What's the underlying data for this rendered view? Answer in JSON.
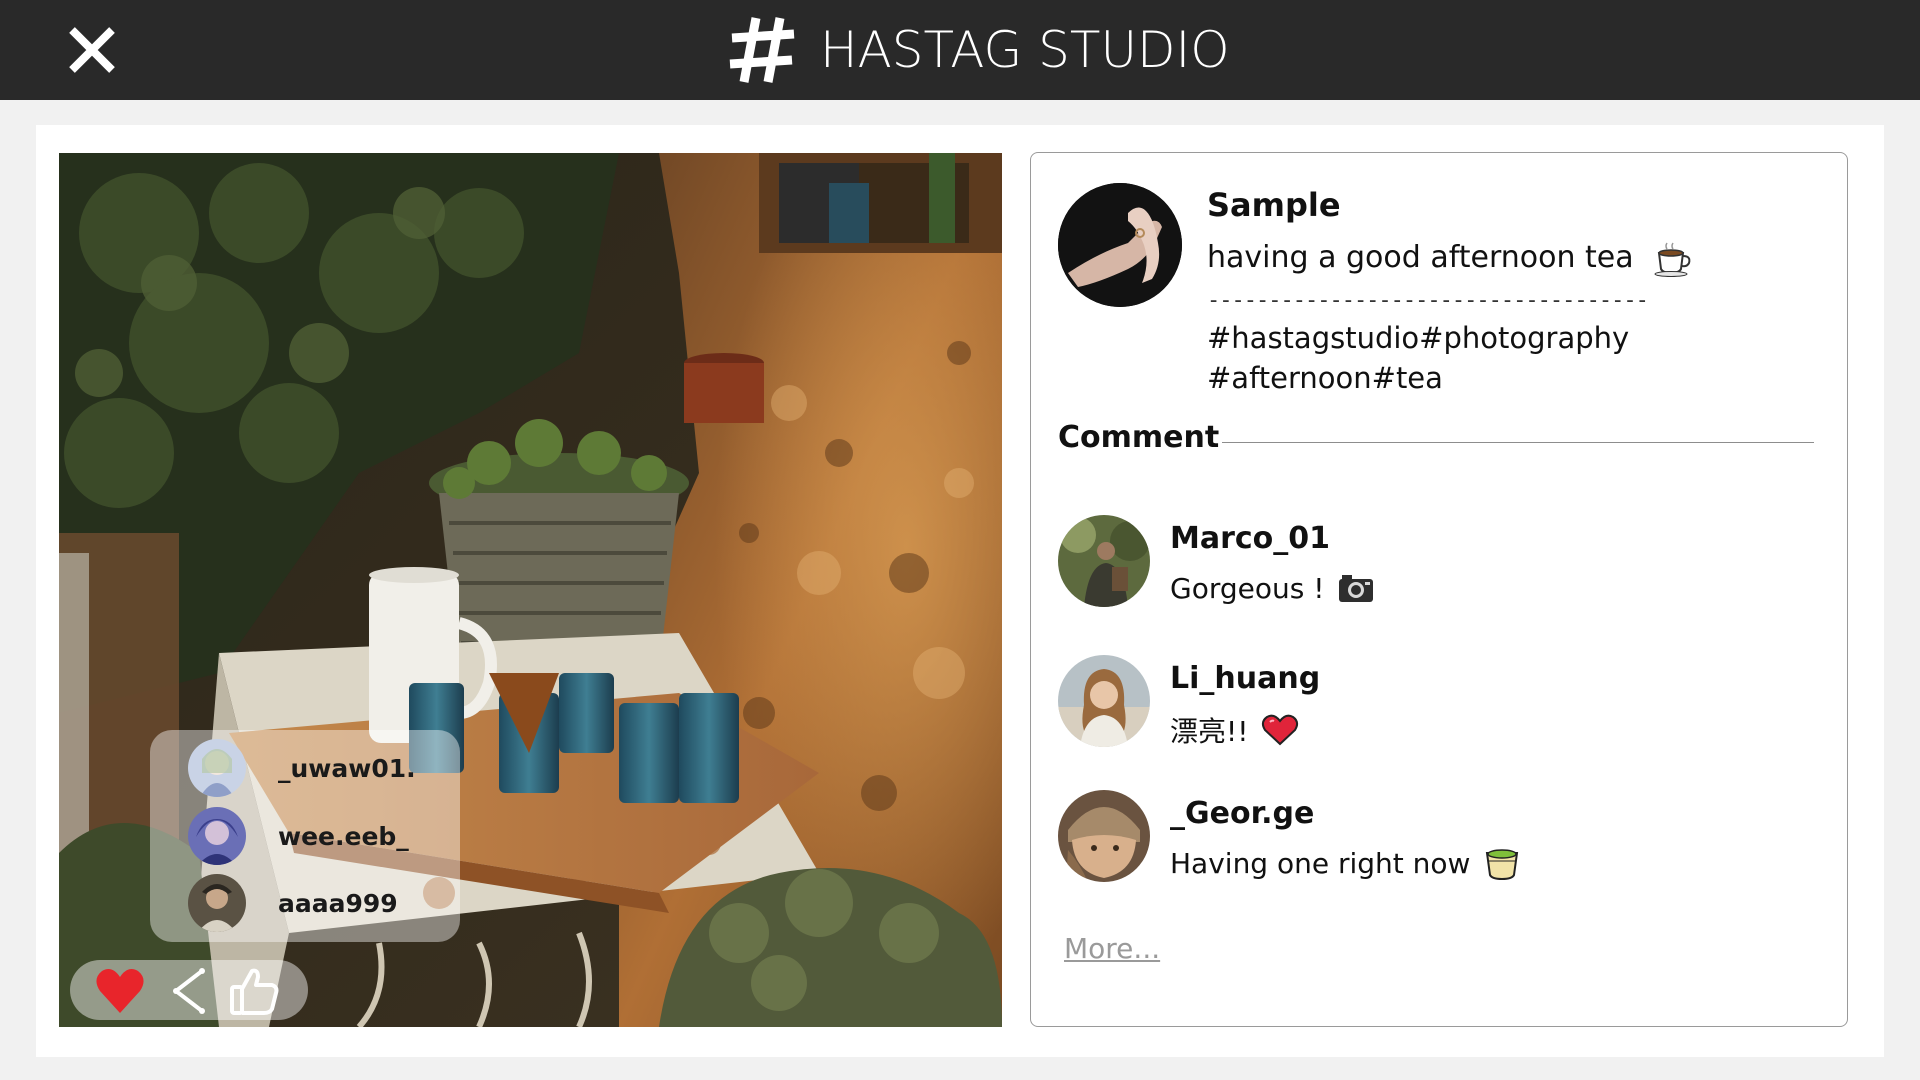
{
  "header": {
    "brand_name": "HASTAG STUDIO",
    "background_color": "#292929",
    "close_icon": "close-icon",
    "brand_icon": "hashtag-icon"
  },
  "photo": {
    "description_icon": "post-photo",
    "viewers": [
      {
        "name": "_uwaw01."
      },
      {
        "name": "wee.eeb_"
      },
      {
        "name": "aaaa999"
      }
    ],
    "actions": [
      {
        "icon": "heart-icon",
        "color": "#e8252b"
      },
      {
        "icon": "share-icon"
      },
      {
        "icon": "thumbs-up-icon"
      }
    ]
  },
  "post": {
    "username": "Sample",
    "caption": "having a good afternoon tea",
    "caption_emoji": "tea-cup-icon",
    "separator": "-------------------------------------------",
    "tags_line1": "#hastagstudio#photography",
    "tags_line2": "#afternoon#tea"
  },
  "comments": {
    "heading": "Comment",
    "items": [
      {
        "username": "Marco_01",
        "text": "Gorgeous !",
        "emoji": "camera-icon"
      },
      {
        "username": "Li_huang",
        "text": "漂亮!!",
        "emoji": "heart-icon"
      },
      {
        "username": "_Geor.ge",
        "text": "Having one right now",
        "emoji": "green-tea-icon"
      }
    ],
    "more_label": "More..."
  }
}
